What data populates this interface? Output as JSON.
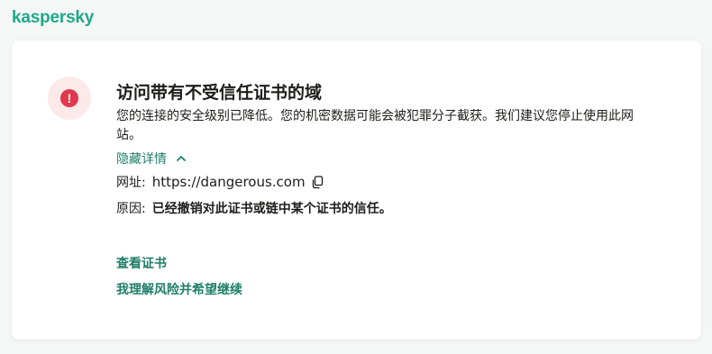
{
  "brand": {
    "logo_text": "kaspersky",
    "accent": "#1ea88a",
    "link_color": "#1e7e68"
  },
  "alert": {
    "icon": "exclamation-icon",
    "icon_glyph": "!",
    "color": "#e0384c"
  },
  "title": "访问带有不受信任证书的域",
  "description": "您的连接的安全级别已降低。您的机密数据可能会被犯罪分子截获。我们建议您停止使用此网站。",
  "details_toggle": {
    "label": "隐藏详情",
    "icon": "chevron-up-icon",
    "expanded": true
  },
  "details": {
    "url_label": "网址:",
    "url_value": "https://dangerous.com",
    "copy_icon": "copy-icon",
    "reason_label": "原因:",
    "reason_value": "已经撤销对此证书或链中某个证书的信任。"
  },
  "actions": {
    "view_certificate": "查看证书",
    "accept_risk": "我理解风险并希望继续"
  }
}
